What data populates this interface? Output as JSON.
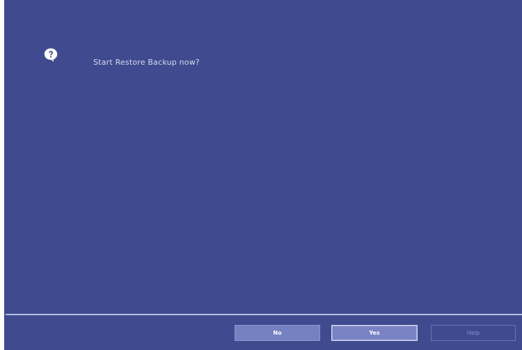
{
  "dialog": {
    "message": "Start Restore Backup now?",
    "icon": "question-bubble-icon"
  },
  "buttons": {
    "no_label": "No",
    "yes_label": "Yes",
    "help_label": "Help"
  },
  "colors": {
    "background": "#3f4b8e",
    "button": "#7681c2",
    "divider": "#b7bde3"
  }
}
